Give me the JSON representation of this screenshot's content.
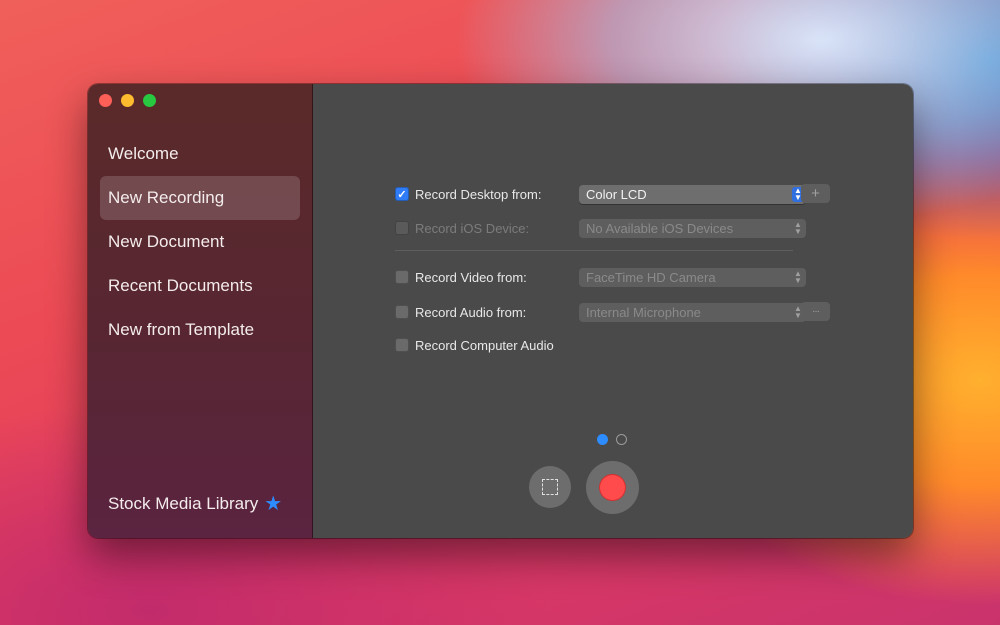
{
  "colors": {
    "accent": "#2f7cf6",
    "record": "#ff4b4b",
    "star": "#2d8cff"
  },
  "sidebar": {
    "items": [
      {
        "label": "Welcome"
      },
      {
        "label": "New Recording"
      },
      {
        "label": "New Document"
      },
      {
        "label": "Recent Documents"
      },
      {
        "label": "New from Template"
      }
    ],
    "active_item": "New Recording",
    "stock_label": "Stock Media Library",
    "stock_icon": "star-icon"
  },
  "recording": {
    "desktop": {
      "label": "Record Desktop from:",
      "checked": true,
      "value": "Color LCD",
      "add_icon": "+"
    },
    "ios": {
      "label": "Record iOS Device:",
      "checked": false,
      "disabled": true,
      "value": "No Available iOS Devices"
    },
    "video": {
      "label": "Record Video from:",
      "checked": false,
      "value": "FaceTime HD Camera"
    },
    "audio": {
      "label": "Record Audio from:",
      "checked": false,
      "value": "Internal Microphone",
      "more_icon": "···"
    },
    "computer_audio": {
      "label": "Record Computer Audio",
      "checked": false
    }
  },
  "pager": {
    "current_page": 1,
    "total_pages": 2
  }
}
